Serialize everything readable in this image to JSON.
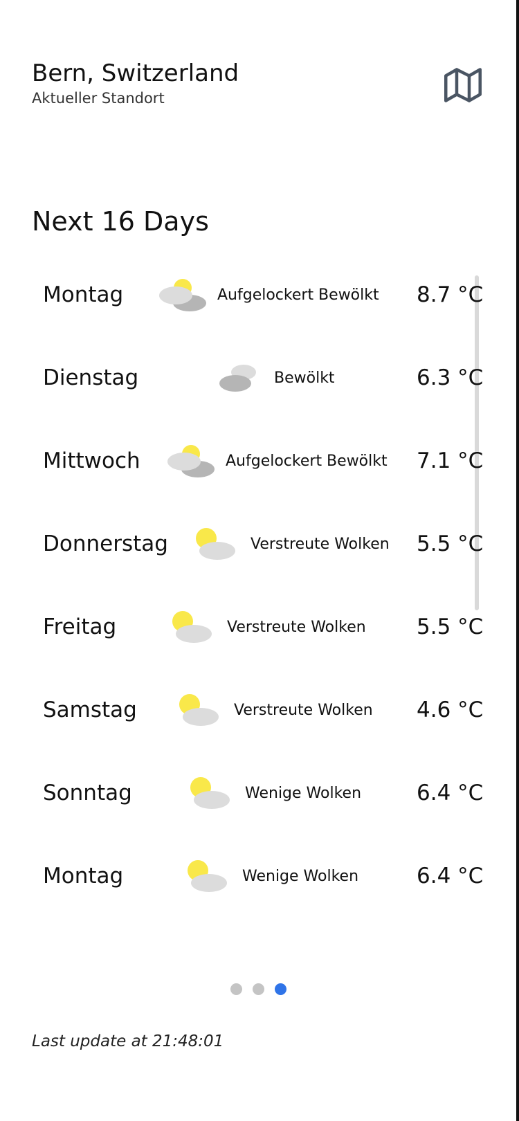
{
  "location": {
    "city": "Bern, Switzerland",
    "subtitle": "Aktueller Standort"
  },
  "forecast": {
    "title": "Next 16 Days",
    "days": [
      {
        "day": "Montag",
        "icon": "sun-behind-cloud-overcast-icon",
        "condition": "Aufgelockert Bewölkt",
        "temp": "8.7 °C"
      },
      {
        "day": "Dienstag",
        "icon": "cloudy-icon",
        "condition": "Bewölkt",
        "temp": "6.3 °C"
      },
      {
        "day": "Mittwoch",
        "icon": "sun-behind-cloud-overcast-icon",
        "condition": "Aufgelockert Bewölkt",
        "temp": "7.1 °C"
      },
      {
        "day": "Donnerstag",
        "icon": "partly-cloudy-icon",
        "condition": "Verstreute Wolken",
        "temp": "5.5 °C"
      },
      {
        "day": "Freitag",
        "icon": "partly-cloudy-icon",
        "condition": "Verstreute Wolken",
        "temp": "5.5 °C"
      },
      {
        "day": "Samstag",
        "icon": "partly-cloudy-icon",
        "condition": "Verstreute Wolken",
        "temp": "4.6 °C"
      },
      {
        "day": "Sonntag",
        "icon": "partly-cloudy-icon",
        "condition": "Wenige Wolken",
        "temp": "6.4 °C"
      },
      {
        "day": "Montag",
        "icon": "partly-cloudy-icon",
        "condition": "Wenige Wolken",
        "temp": "6.4 °C"
      }
    ]
  },
  "pager": {
    "pages": 3,
    "active": 3
  },
  "footer": {
    "last_update": "Last update at 21:48:01"
  },
  "colors": {
    "accent": "#2f74e8",
    "sun": "#f9e84a",
    "cloud_light": "#dcdcdc",
    "cloud_dark": "#b5b5b5",
    "icon_stroke": "#4a5563"
  }
}
